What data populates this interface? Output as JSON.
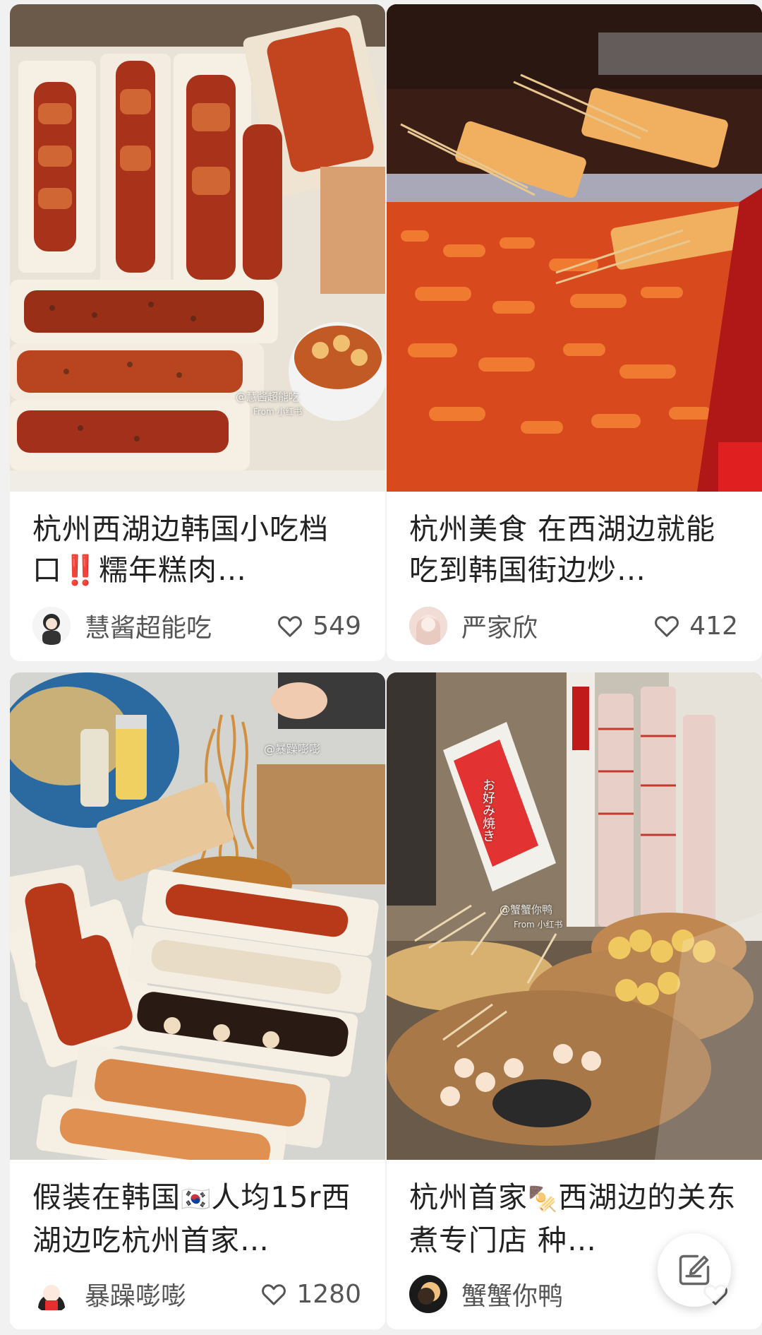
{
  "feed": {
    "cards": [
      {
        "title": "杭州西湖边韩国小吃档口‼️糯年糕肉…",
        "author": "慧酱超能吃",
        "likes": "549",
        "photo_watermark": "@慧酱超能吃",
        "photo_watermark2": "From 小红书",
        "photo_icon": "korean-street-skewers-photo"
      },
      {
        "title": "杭州美食 在西湖边就能吃到韩国街边炒…",
        "author": "严家欣",
        "likes": "412",
        "photo_icon": "tteokbokki-stall-photo"
      },
      {
        "title_part1": "假装在韩国",
        "title_flag": "🇰🇷",
        "title_part2": "人均15r西湖边吃杭州首家…",
        "author": "暴躁嘭嘭",
        "likes": "1280",
        "photo_watermark": "@暴躁嘭嘭",
        "photo_icon": "noodles-and-skewers-photo"
      },
      {
        "title_part1": "杭州首家",
        "title_emoji": "🍢",
        "title_part2": "西湖边的关东煮专门店 种…",
        "author": "蟹蟹你鸭",
        "likes": "",
        "photo_watermark": "@蟹蟹你鸭",
        "photo_watermark2": "From 小红书",
        "photo_sign": "お好み焼き",
        "photo_icon": "oden-shop-photo"
      }
    ]
  },
  "fab": {
    "icon": "edit-note-icon"
  },
  "colors": {
    "background": "#f1f1f1",
    "card": "#ffffff",
    "text": "#222222",
    "meta": "#555555"
  }
}
